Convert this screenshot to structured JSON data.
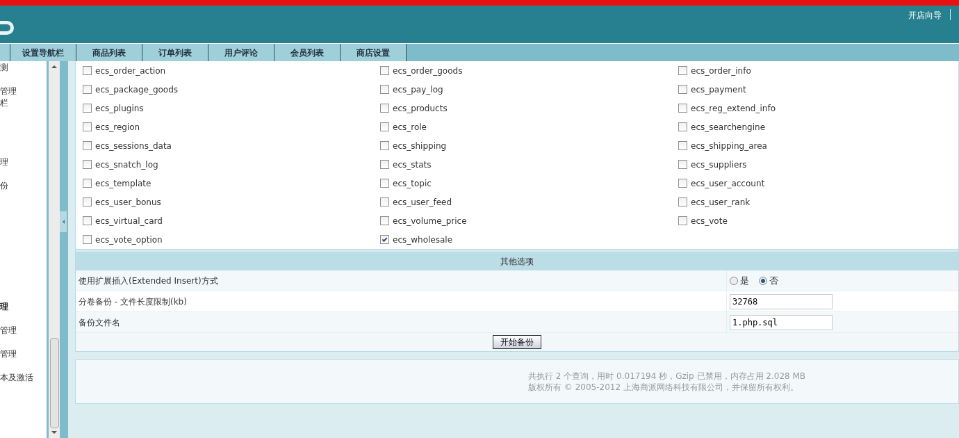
{
  "header": {
    "links": [
      "开店向导"
    ]
  },
  "tabs": [
    {
      "label": "设置导航栏"
    },
    {
      "label": "商品列表"
    },
    {
      "label": "订单列表"
    },
    {
      "label": "用户评论"
    },
    {
      "label": "会员列表"
    },
    {
      "label": "商店设置"
    }
  ],
  "sidebar": {
    "items": [
      {
        "label": "测",
        "bold": false
      },
      {
        "label": "管理",
        "bold": false
      },
      {
        "label": "栏",
        "bold": false
      },
      {
        "label": "理",
        "bold": false
      },
      {
        "label": "份",
        "bold": false
      },
      {
        "label": "理",
        "bold": true
      },
      {
        "label": "管理",
        "bold": false
      },
      {
        "label": "管理",
        "bold": false
      },
      {
        "label": "本及激活",
        "bold": false
      }
    ]
  },
  "tables": [
    {
      "name": "ecs_order_action",
      "checked": false
    },
    {
      "name": "ecs_order_goods",
      "checked": false
    },
    {
      "name": "ecs_order_info",
      "checked": false
    },
    {
      "name": "ecs_package_goods",
      "checked": false
    },
    {
      "name": "ecs_pay_log",
      "checked": false
    },
    {
      "name": "ecs_payment",
      "checked": false
    },
    {
      "name": "ecs_plugins",
      "checked": false
    },
    {
      "name": "ecs_products",
      "checked": false
    },
    {
      "name": "ecs_reg_extend_info",
      "checked": false
    },
    {
      "name": "ecs_region",
      "checked": false
    },
    {
      "name": "ecs_role",
      "checked": false
    },
    {
      "name": "ecs_searchengine",
      "checked": false
    },
    {
      "name": "ecs_sessions_data",
      "checked": false
    },
    {
      "name": "ecs_shipping",
      "checked": false
    },
    {
      "name": "ecs_shipping_area",
      "checked": false
    },
    {
      "name": "ecs_snatch_log",
      "checked": false
    },
    {
      "name": "ecs_stats",
      "checked": false
    },
    {
      "name": "ecs_suppliers",
      "checked": false
    },
    {
      "name": "ecs_template",
      "checked": false
    },
    {
      "name": "ecs_topic",
      "checked": false
    },
    {
      "name": "ecs_user_account",
      "checked": false
    },
    {
      "name": "ecs_user_bonus",
      "checked": false
    },
    {
      "name": "ecs_user_feed",
      "checked": false
    },
    {
      "name": "ecs_user_rank",
      "checked": false
    },
    {
      "name": "ecs_virtual_card",
      "checked": false
    },
    {
      "name": "ecs_volume_price",
      "checked": false
    },
    {
      "name": "ecs_vote",
      "checked": false
    },
    {
      "name": "ecs_vote_option",
      "checked": false
    },
    {
      "name": "ecs_wholesale",
      "checked": true
    }
  ],
  "options": {
    "title": "其他选项",
    "rows": [
      {
        "kind": "radio",
        "label": "使用扩展插入(Extended Insert)方式",
        "choices": [
          {
            "label": "是",
            "selected": false
          },
          {
            "label": "否",
            "selected": true
          }
        ]
      },
      {
        "kind": "input",
        "label": "分卷备份 - 文件长度限制(kb)",
        "value": "32768"
      },
      {
        "kind": "input",
        "label": "备份文件名",
        "value": "1.php.sql"
      }
    ],
    "submit": "开始备份"
  },
  "footer": [
    "共执行 2 个查询，用时 0.017194 秒，Gzip 已禁用，内存占用 2.028 MB",
    "版权所有 © 2005-2012 上海商派网络科技有限公司，并保留所有权利。"
  ]
}
